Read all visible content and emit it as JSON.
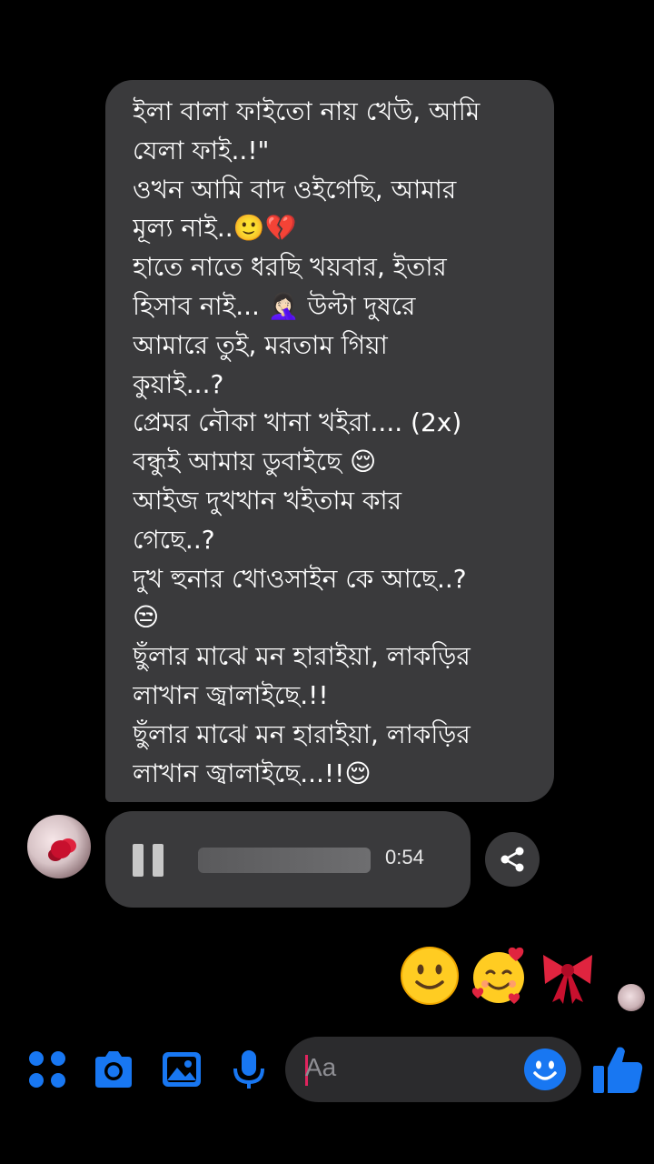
{
  "message": {
    "lines": [
      "ইলা বালা ফাইতো নায় খেউ, আমি",
      "যেলা ফাই..!\"",
      "ওখন আমি বাদ ওইগেছি, আমার",
      "মূল্য নাই..🙂💔",
      "হাতে নাতে ধরছি খয়বার, ইতার",
      "হিসাব নাই... 🤦🏻‍♀️ উল্টা দুষরে",
      "আমারে তুই, মরতাম গিয়া",
      "কুয়াই...?",
      "প্রেমর নৌকা খানা খইরা.... (2x)",
      "বন্ধুই আমায় ডুবাইছে 😌",
      "আইজ দুখখান খইতাম কার",
      "গেছে..?",
      "দুখ হুনার খোওসাইন কে আছে..?",
      "😒",
      "ছুঁলার মাঝে মন হারাইয়া, লাকড়ির",
      "লাখান জ্বালাইছে.!!",
      "ছুঁলার মাঝে মন হারাইয়া, লাকড়ির",
      "লাখান জ্বালাইছে...!!😌"
    ]
  },
  "voice": {
    "duration": "0:54",
    "state_icon": "pause-icon",
    "progress": 0
  },
  "share": {
    "icon": "share-icon"
  },
  "reactions": {
    "icons": [
      "slightly-smiling-face-icon",
      "smiling-face-with-hearts-icon",
      "ribbon-icon"
    ]
  },
  "composer": {
    "placeholder": "Aa",
    "icons": [
      "apps-icon",
      "camera-icon",
      "image-icon",
      "microphone-icon",
      "emoji-icon",
      "like-icon"
    ]
  },
  "colors": {
    "bubble": "#3a3a3c",
    "accent": "#1877f2",
    "background": "#000000"
  }
}
